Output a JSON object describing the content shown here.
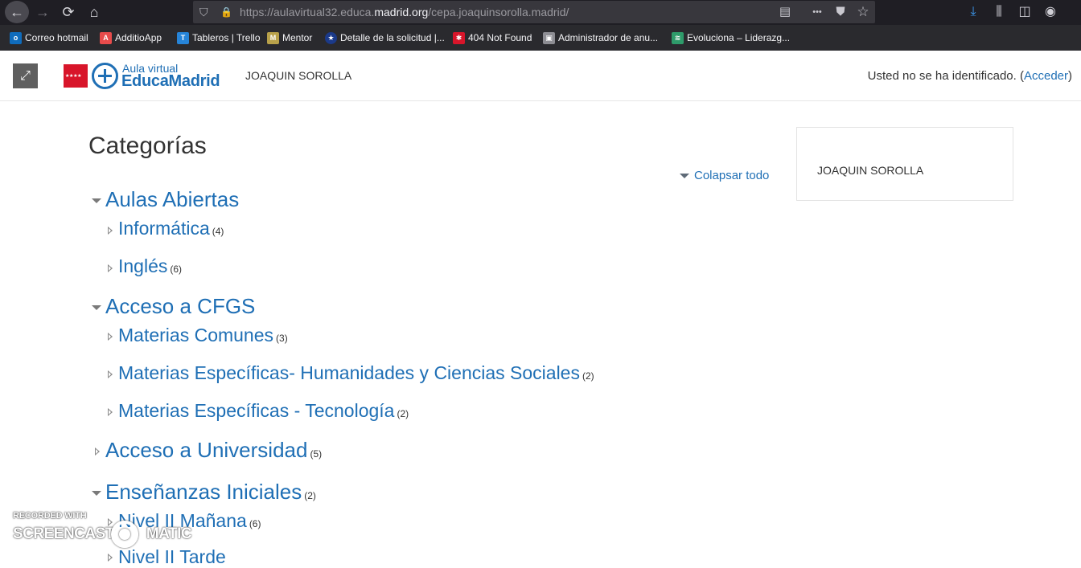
{
  "browser": {
    "url_prefix": "https://aulavirtual32.educa.",
    "url_domain": "madrid.org",
    "url_path": "/cepa.joaquinsorolla.madrid/",
    "icons": {
      "back": "←",
      "forward": "→",
      "reload": "⟳",
      "home": "⌂",
      "shield": "⛉",
      "lock": "🔒",
      "reader": "▤",
      "more": "•••",
      "pocket": "⛊",
      "star": "☆",
      "download": "⤓",
      "library": "⫼",
      "sidebar": "◫",
      "account": "◉"
    }
  },
  "bookmarks": [
    {
      "label": "Correo hotmail",
      "icon_text": "o",
      "color": "#0f6cbd"
    },
    {
      "label": "AdditioApp",
      "icon_text": "A",
      "color": "#e84b4b"
    },
    {
      "label": "Tableros | Trello",
      "icon_text": "T",
      "color": "#2684d8"
    },
    {
      "label": "Mentor",
      "icon_text": "M",
      "color": "#b8a14a"
    },
    {
      "label": "Detalle de la solicitud |...",
      "icon_text": "★",
      "color": "#1b3a8a"
    },
    {
      "label": "404 Not Found",
      "icon_text": "✱",
      "color": "#d8152a"
    },
    {
      "label": "Administrador de anu...",
      "icon_text": "▣",
      "color": "#8d8d93"
    },
    {
      "label": "Evoluciona – Liderazg...",
      "icon_text": "≋",
      "color": "#2e9b6a"
    }
  ],
  "header": {
    "expand_icon": "⤢",
    "flag_stars": "★ ★ ★ ★",
    "logo_small": "Aula virtual",
    "logo_big": "EducaMadrid",
    "site_name": "JOAQUIN SOROLLA",
    "login_text": "Usted no se ha identificado. (",
    "login_link": "Acceder",
    "login_close": ")"
  },
  "main": {
    "title": "Categorías",
    "collapse_all": "Colapsar todo",
    "categories": [
      {
        "label": "Aulas Abiertas",
        "count": ""
      },
      {
        "label": "Informática",
        "count": "(4)"
      },
      {
        "label": "Inglés",
        "count": "(6)"
      },
      {
        "label": "Acceso a CFGS",
        "count": ""
      },
      {
        "label": "Materias Comunes",
        "count": "(3)"
      },
      {
        "label": "Materias Específicas- Humanidades y Ciencias Sociales",
        "count": "(2)"
      },
      {
        "label": "Materias Específicas - Tecnología",
        "count": "(2)"
      },
      {
        "label": "Acceso a Universidad",
        "count": "(5)"
      },
      {
        "label": "Enseñanzas Iniciales",
        "count": "(2)"
      },
      {
        "label": "Nivel II Mañana",
        "count": "(6)"
      },
      {
        "label": "Nivel II Tarde",
        "count": ""
      }
    ]
  },
  "side_block": {
    "text": "JOAQUIN SOROLLA"
  },
  "watermark": {
    "line1": "RECORDED WITH",
    "line2a": "SCREENCAST",
    "line2b": "MATIC"
  }
}
